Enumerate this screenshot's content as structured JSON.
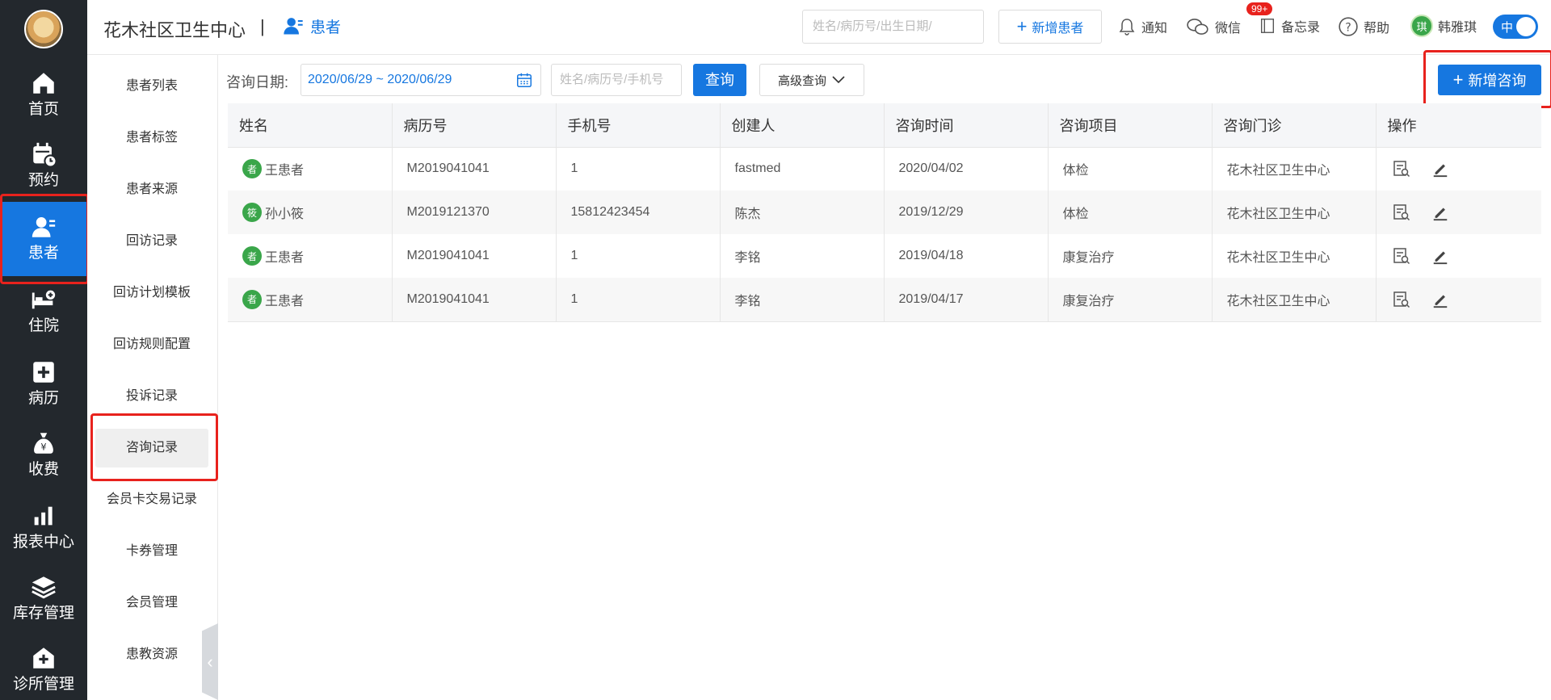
{
  "nav": {
    "items": [
      {
        "label": "首页",
        "icon": "home-icon"
      },
      {
        "label": "预约",
        "icon": "calendar-icon"
      },
      {
        "label": "患者",
        "icon": "patient-icon"
      },
      {
        "label": "住院",
        "icon": "bed-icon"
      },
      {
        "label": "病历",
        "icon": "medical-record-icon"
      },
      {
        "label": "收费",
        "icon": "money-bag-icon"
      },
      {
        "label": "报表中心",
        "icon": "bar-chart-icon"
      },
      {
        "label": "库存管理",
        "icon": "layers-icon"
      },
      {
        "label": "诊所管理",
        "icon": "clinic-icon"
      }
    ],
    "active_index": 2
  },
  "header": {
    "org_name": "花木社区卫生中心",
    "separator": "|",
    "module": "患者",
    "search_placeholder": "姓名/病历号/出生日期/",
    "add_patient": "新增患者",
    "notify": "通知",
    "notify_badge": "99+",
    "wechat": "微信",
    "memo": "备忘录",
    "help": "帮助",
    "user_avatar_char": "琪",
    "user_name": "韩雅琪",
    "toggle_label": "中"
  },
  "subnav": {
    "items": [
      "患者列表",
      "患者标签",
      "患者来源",
      "回访记录",
      "回访计划模板",
      "回访规则配置",
      "投诉记录",
      "咨询记录",
      "会员卡交易记录",
      "卡券管理",
      "会员管理",
      "患教资源"
    ],
    "active_index": 7
  },
  "filters": {
    "date_label": "咨询日期:",
    "date_range": "2020/06/29 ~ 2020/06/29",
    "search_placeholder": "姓名/病历号/手机号",
    "query_button": "查询",
    "advanced_button": "高级查询",
    "new_button": "新增咨询"
  },
  "table": {
    "columns": [
      "姓名",
      "病历号",
      "手机号",
      "创建人",
      "咨询时间",
      "咨询项目",
      "咨询门诊",
      "操作"
    ],
    "rows": [
      {
        "avatar": "者",
        "name": "王患者",
        "record": "M2019041041",
        "phone": "1",
        "creator": "fastmed",
        "time": "2020/04/02",
        "item": "体检",
        "clinic": "花木社区卫生中心"
      },
      {
        "avatar": "筱",
        "name": "孙小筱",
        "record": "M2019121370",
        "phone": "15812423454",
        "creator": "陈杰",
        "time": "2019/12/29",
        "item": "体检",
        "clinic": "花木社区卫生中心"
      },
      {
        "avatar": "者",
        "name": "王患者",
        "record": "M2019041041",
        "phone": "1",
        "creator": "李铭",
        "time": "2019/04/18",
        "item": "康复治疗",
        "clinic": "花木社区卫生中心"
      },
      {
        "avatar": "者",
        "name": "王患者",
        "record": "M2019041041",
        "phone": "1",
        "creator": "李铭",
        "time": "2019/04/17",
        "item": "康复治疗",
        "clinic": "花木社区卫生中心"
      }
    ]
  },
  "colors": {
    "accent": "#1677e0",
    "nav_bg": "#23282d",
    "highlight": "#e8221d",
    "avatar_green": "#3aa64a"
  }
}
